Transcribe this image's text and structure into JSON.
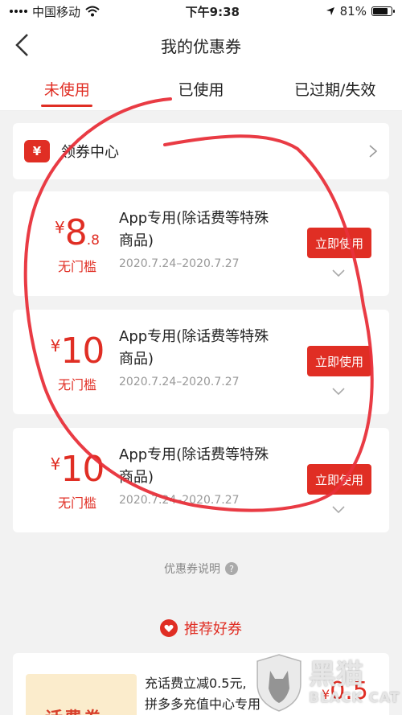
{
  "status_bar": {
    "carrier": "中国移动",
    "time": "下午9:38",
    "battery": "81%"
  },
  "nav": {
    "title": "我的优惠券"
  },
  "tabs": [
    {
      "label": "未使用"
    },
    {
      "label": "已使用"
    },
    {
      "label": "已过期/失效"
    }
  ],
  "coupon_center": {
    "icon": "¥",
    "label": "领券中心"
  },
  "coupons": [
    {
      "currency": "¥",
      "amount": "8",
      "decimal": ".8",
      "condition": "无门槛",
      "desc": "App专用(除话费等特殊商品)",
      "date": "2020.7.24–2020.7.27",
      "button": "立即使用"
    },
    {
      "currency": "¥",
      "amount": "10",
      "decimal": "",
      "condition": "无门槛",
      "desc": "App专用(除话费等特殊商品)",
      "date": "2020.7.24–2020.7.27",
      "button": "立即使用"
    },
    {
      "currency": "¥",
      "amount": "10",
      "decimal": "",
      "condition": "无门槛",
      "desc": "App专用(除话费等特殊商品)",
      "date": "2020.7.24–2020.7.27",
      "button": "立即使用"
    }
  ],
  "explain": {
    "label": "优惠券说明",
    "icon": "?"
  },
  "recommend": {
    "title": "推荐好券"
  },
  "rec_coupon": {
    "thumb_label": "话费券",
    "line1": "充话费立减0.5元,",
    "line2": "拼多多充值中心专用",
    "currency": "¥",
    "amount": "0.5"
  },
  "watermark": {
    "cn": "黑猫",
    "en": "BLACK CAT"
  },
  "colors": {
    "accent": "#e02e24",
    "annotation": "#e8303a"
  }
}
